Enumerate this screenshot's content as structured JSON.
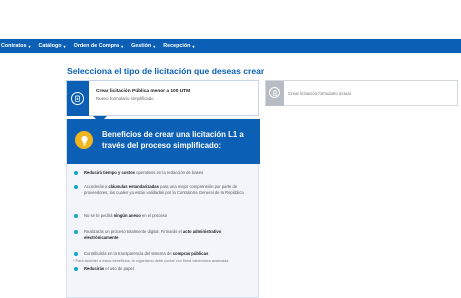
{
  "nav": {
    "items": [
      {
        "label": "Contratos"
      },
      {
        "label": "Catálogo"
      },
      {
        "label": "Orden de Compra"
      },
      {
        "label": "Gestión"
      },
      {
        "label": "Recepción"
      }
    ],
    "caret": "▾"
  },
  "page": {
    "title": "Selecciona el tipo de licitación que deseas crear"
  },
  "option_simplified": {
    "title": "Crear licitación Pública menor a 100 UTM",
    "subtitle": "Nuevo formulario simplificado",
    "icon": "clipboard-plus-icon"
  },
  "option_current": {
    "title": "Crear licitación formulario actual",
    "icon": "clipboard-plus-icon"
  },
  "benefits": {
    "title": "Beneficios de crear una licitación L1 a través del proceso simplificado:",
    "icon": "lightbulb-icon",
    "items": [
      {
        "bold_1": "Reducirá tiempo y costos",
        "text_1": " operativos en la redacción de bases"
      },
      {
        "text_1": "Accederás a ",
        "bold_1": "cláusulas estandarizadas",
        "text_2": " para una mejor comprensión por parte de proveedores, las cuales ya están validadas por la Contraloría General de la República"
      },
      {
        "text_1": "No se te pedirá ",
        "bold_1": "ningún anexo",
        "text_2": " en el proceso"
      },
      {
        "text_1": "Realizarás un proceso totalmente digital. Firmarás el ",
        "bold_1": "acto administrativo electrónicamente"
      },
      {
        "text_1": "Contribuirás en la transparencia del sistema de ",
        "bold_1": "compras públicas"
      },
      {
        "bold_1": "Reducirás",
        "text_1": " el uso de papel"
      }
    ],
    "footnote": "* Para acceder a estos beneficios, tu organismo debe contar con firma electrónica avanzada"
  },
  "colors": {
    "brand_blue": "#0b60b5",
    "bullet": "#19a4c9",
    "bulb": "#f0b41c"
  }
}
